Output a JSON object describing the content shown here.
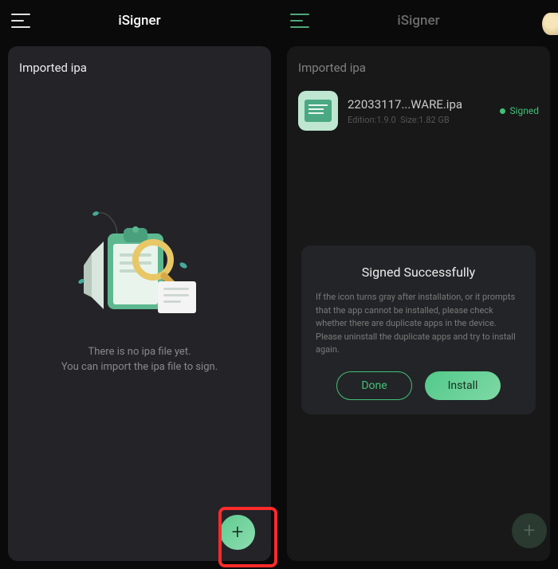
{
  "left": {
    "appTitle": "iSigner",
    "cardTitle": "Imported ipa",
    "emptyLine1": "There is no ipa file yet.",
    "emptyLine2": "You can import the ipa file to sign.",
    "fabLabel": "+"
  },
  "right": {
    "appTitle": "iSigner",
    "cardTitle": "Imported ipa",
    "app": {
      "name": "22033117...WARE.ipa",
      "editionLabel": "Edition:",
      "editionValue": "1.9.0",
      "sizeLabel": "Size:",
      "sizeValue": "1.82 GB",
      "status": "Signed"
    },
    "dialog": {
      "title": "Signed Successfully",
      "body": "If the icon turns gray after installation, or it prompts that the app cannot be installed, please check whether there are duplicate apps in the device. Please uninstall the duplicate apps and try to install again.",
      "done": "Done",
      "install": "Install"
    },
    "fabLabel": "+"
  }
}
